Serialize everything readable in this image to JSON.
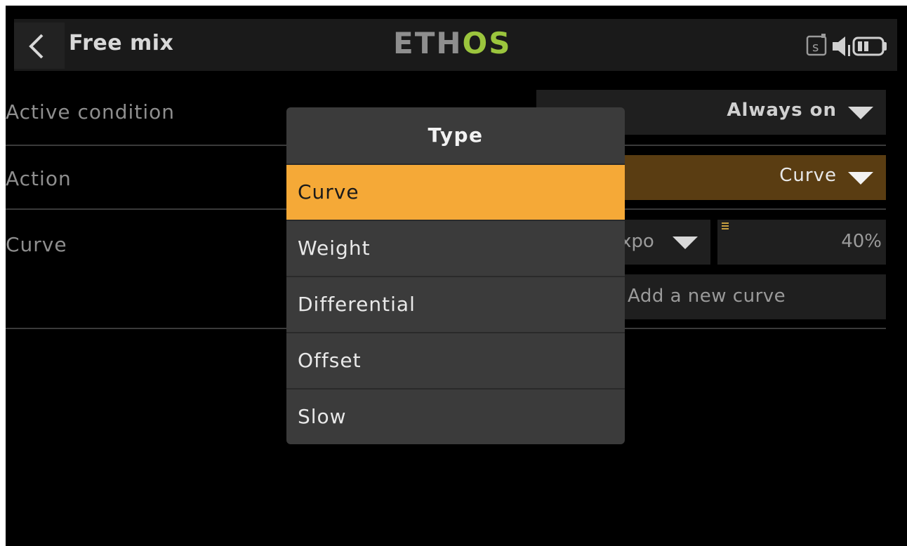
{
  "header": {
    "back_icon": "chevron-left-icon",
    "title": "Free mix",
    "brand_part1": "ETH",
    "brand_part2": "OS",
    "status_icons": [
      "sd-card-icon",
      "speaker-icon",
      "battery-icon"
    ]
  },
  "form": {
    "active_condition": {
      "label": "Active condition",
      "value": "Always on"
    },
    "action": {
      "label": "Action",
      "value": "Curve"
    },
    "curve": {
      "label": "Curve",
      "type_value": "Expo",
      "type_visible": "xpo",
      "value": "40%",
      "add_label": "Add a new curve"
    }
  },
  "colors": {
    "accent": "#f5a937",
    "action_field_bg": "#5a3d12",
    "brand_green": "#9bc53d"
  },
  "modal": {
    "title": "Type",
    "options": [
      {
        "label": "Curve",
        "selected": true
      },
      {
        "label": "Weight",
        "selected": false
      },
      {
        "label": "Differential",
        "selected": false
      },
      {
        "label": "Offset",
        "selected": false
      },
      {
        "label": "Slow",
        "selected": false
      }
    ]
  }
}
